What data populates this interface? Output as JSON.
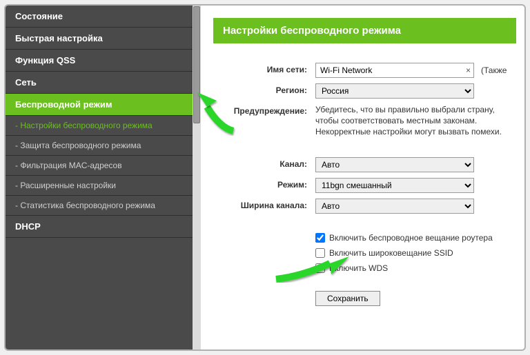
{
  "sidebar": {
    "items": [
      {
        "label": "Состояние"
      },
      {
        "label": "Быстрая настройка"
      },
      {
        "label": "Функция QSS"
      },
      {
        "label": "Сеть"
      },
      {
        "label": "Беспроводной режим"
      },
      {
        "label": "DHCP"
      }
    ],
    "subitems": [
      {
        "label": "- Настройки беспроводного режима"
      },
      {
        "label": "- Защита беспроводного режима"
      },
      {
        "label": "- Фильтрация MAC-адресов"
      },
      {
        "label": "- Расширенные настройки"
      },
      {
        "label": "- Статистика беспроводного режима"
      }
    ]
  },
  "panel": {
    "title": "Настройки беспроводного режима"
  },
  "form": {
    "ssid_label": "Имя сети:",
    "ssid_value": "Wi-Fi Network",
    "also_text": "(Также",
    "region_label": "Регион:",
    "region_value": "Россия",
    "warning_label": "Предупреждение:",
    "warning_text": "Убедитесь, что вы правильно выбрали страну, чтобы соответствовать местным законам. Некорректные настройки могут вызвать помехи.",
    "channel_label": "Канал:",
    "channel_value": "Авто",
    "mode_label": "Режим:",
    "mode_value": "11bgn смешанный",
    "width_label": "Ширина канала:",
    "width_value": "Авто",
    "cb_broadcast_router": "Включить беспроводное вещание роутера",
    "cb_broadcast_ssid": "Включить широковещание SSID",
    "cb_wds": "Включить WDS",
    "save_label": "Сохранить"
  }
}
